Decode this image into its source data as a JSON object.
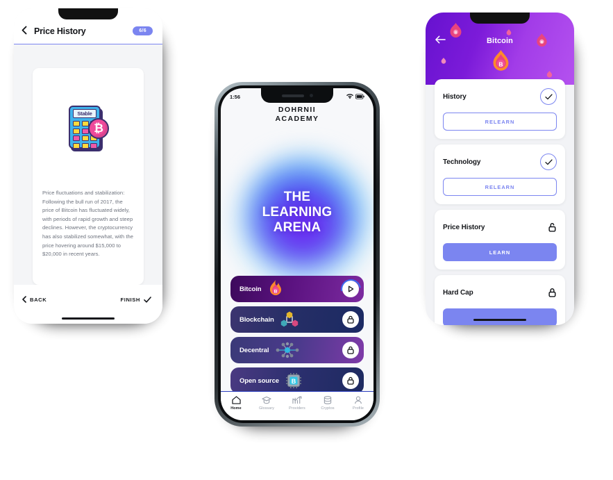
{
  "left_phone": {
    "header": {
      "back_icon": "chevron-left-icon",
      "title": "Price History",
      "badge": "6/6"
    },
    "illustration": {
      "name": "calculator-bitcoin-illustration",
      "screen_label": "Stable",
      "coin_symbol": "₿"
    },
    "body_text": "Price fluctuations and stabilization: Following the bull run of 2017, the price of Bitcoin has fluctuated widely, with periods of rapid growth and steep declines. However, the cryptocurrency has also stabilized somewhat, with the price hovering around $15,000 to $20,000 in recent years.",
    "footer": {
      "back_label": "BACK",
      "finish_label": "FINISH"
    }
  },
  "center_phone": {
    "status": {
      "time": "1:56",
      "wifi_icon": "wifi-icon",
      "battery_icon": "battery-icon"
    },
    "logo_line1": "DOHRNII",
    "logo_line2": "ACADEMY",
    "hero_title": "THE LEARNING ARENA",
    "hero_lines": [
      "THE",
      "LEARNING",
      "ARENA"
    ],
    "lessons": [
      {
        "label": "Bitcoin",
        "icon": "flame-bitcoin-icon",
        "action": "play",
        "action_icon": "play-icon",
        "locked": false
      },
      {
        "label": "Blockchain",
        "icon": "blockchain-nodes-icon",
        "action": "lock",
        "action_icon": "lock-icon",
        "locked": true
      },
      {
        "label": "Decentral",
        "icon": "decentralized-network-icon",
        "action": "lock",
        "action_icon": "lock-icon",
        "locked": true
      },
      {
        "label": "Open source",
        "icon": "chip-bitcoin-icon",
        "action": "lock",
        "action_icon": "lock-icon",
        "locked": true
      }
    ],
    "tabs": [
      {
        "label": "Home",
        "icon": "home-icon",
        "active": true
      },
      {
        "label": "Glossary",
        "icon": "graduation-cap-icon",
        "active": false
      },
      {
        "label": "Providers",
        "icon": "chart-up-icon",
        "active": false
      },
      {
        "label": "Cryptos",
        "icon": "database-icon",
        "active": false
      },
      {
        "label": "Profile",
        "icon": "person-icon",
        "active": false
      }
    ]
  },
  "right_phone": {
    "header": {
      "back_icon": "arrow-left-icon",
      "title": "Bitcoin"
    },
    "cards": [
      {
        "title": "History",
        "status_icon": "check-circle-icon",
        "button": "RELEARN",
        "button_style": "outline"
      },
      {
        "title": "Technology",
        "status_icon": "check-circle-icon",
        "button": "RELEARN",
        "button_style": "outline"
      },
      {
        "title": "Price History",
        "status_icon": "unlock-icon",
        "button": "LEARN",
        "button_style": "filled"
      },
      {
        "title": "Hard Cap",
        "status_icon": "lock-icon",
        "button": "",
        "button_style": "filled"
      }
    ]
  },
  "colors": {
    "accent_purple": "#7b85f0",
    "header_purple": "#7c1bd9",
    "orb_violet": "#6b2ef2",
    "orb_cyan": "#53c6f5",
    "text_dark": "#14161a",
    "text_muted": "#6e737e"
  }
}
